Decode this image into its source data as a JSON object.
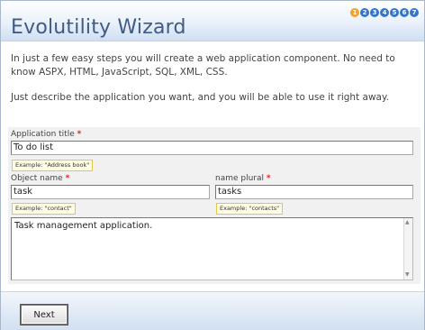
{
  "header": {
    "title": "Evolutility Wizard",
    "steps": [
      "1",
      "2",
      "3",
      "4",
      "5",
      "6",
      "7"
    ],
    "active_step": 1
  },
  "intro": {
    "line1": "In just a few easy steps you will create a web application component. No need to know ASPX, HTML, JavaScript, SQL, XML, CSS.",
    "line2": "Just describe the application you want, and you will be able to use it right away."
  },
  "form": {
    "app_title": {
      "label": "Application title",
      "required_mark": "*",
      "value": "To do list",
      "hint": "Example: \"Address book\""
    },
    "object_name": {
      "label": "Object name",
      "required_mark": "*",
      "value": "task",
      "hint": "Example: \"contact\""
    },
    "name_plural": {
      "label": "name plural",
      "required_mark": "*",
      "value": "tasks",
      "hint": "Example: \"contacts\""
    },
    "description": {
      "value": "Task management application."
    }
  },
  "footer": {
    "next_label": "Next"
  },
  "colors": {
    "title": "#3f5b86",
    "step": "#3874c6",
    "step_active": "#f0a22e",
    "required": "#e0211b",
    "hint_bg": "#fffde3"
  }
}
